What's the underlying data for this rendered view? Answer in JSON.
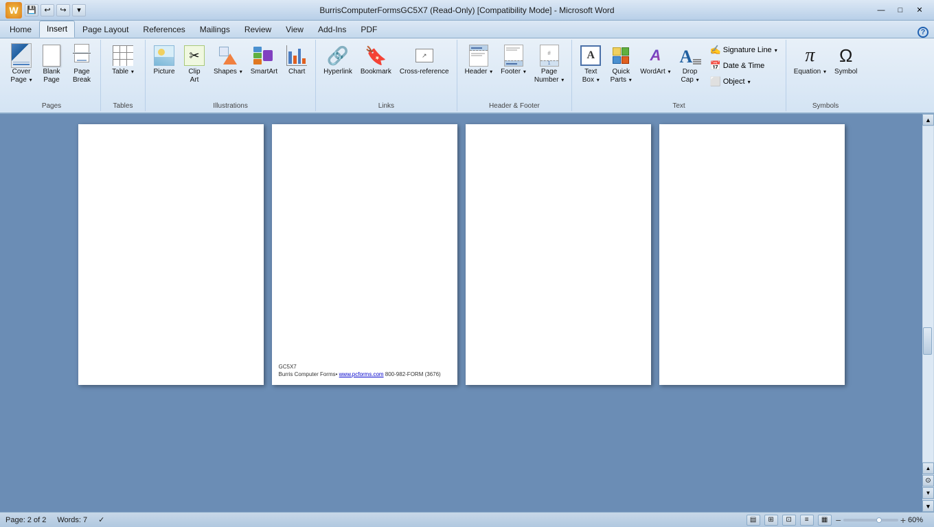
{
  "titlebar": {
    "title": "BurrisComputerFormsGC5X7 (Read-Only) [Compatibility Mode] - Microsoft Word",
    "min": "—",
    "max": "□",
    "close": "✕"
  },
  "quickaccess": {
    "save": "💾",
    "undo": "↩",
    "redo": "↪"
  },
  "tabs": [
    {
      "label": "Home"
    },
    {
      "label": "Insert"
    },
    {
      "label": "Page Layout"
    },
    {
      "label": "References"
    },
    {
      "label": "Mailings"
    },
    {
      "label": "Review"
    },
    {
      "label": "View"
    },
    {
      "label": "Add-Ins"
    },
    {
      "label": "PDF"
    }
  ],
  "activeTab": "Insert",
  "groups": {
    "pages": {
      "label": "Pages",
      "buttons": [
        {
          "id": "cover-page",
          "label": "Cover\nPage",
          "icon": "📄"
        },
        {
          "id": "blank-page",
          "label": "Blank\nPage",
          "icon": "🗋"
        },
        {
          "id": "page-break",
          "label": "Page\nBreak",
          "icon": "⋯"
        }
      ]
    },
    "tables": {
      "label": "Tables",
      "buttons": [
        {
          "id": "table",
          "label": "Table",
          "icon": "⊞"
        }
      ]
    },
    "illustrations": {
      "label": "Illustrations",
      "buttons": [
        {
          "id": "picture",
          "label": "Picture",
          "icon": "🖼"
        },
        {
          "id": "clip-art",
          "label": "Clip\nArt",
          "icon": "✂"
        },
        {
          "id": "shapes",
          "label": "Shapes",
          "icon": "△"
        },
        {
          "id": "smartart",
          "label": "SmartArt",
          "icon": "⬡"
        },
        {
          "id": "chart",
          "label": "Chart",
          "icon": "📊"
        }
      ]
    },
    "links": {
      "label": "Links",
      "buttons": [
        {
          "id": "hyperlink",
          "label": "Hyperlink",
          "icon": "🔗"
        },
        {
          "id": "bookmark",
          "label": "Bookmark",
          "icon": "🔖"
        },
        {
          "id": "cross-reference",
          "label": "Cross-reference",
          "icon": "↗"
        }
      ]
    },
    "header-footer": {
      "label": "Header & Footer",
      "buttons": [
        {
          "id": "header",
          "label": "Header",
          "icon": "▤"
        },
        {
          "id": "footer",
          "label": "Footer",
          "icon": "▥"
        },
        {
          "id": "page-number",
          "label": "Page\nNumber",
          "icon": "#"
        }
      ]
    },
    "text": {
      "label": "Text",
      "buttons_large": [
        {
          "id": "text-box",
          "label": "Text\nBox",
          "icon": "▭"
        },
        {
          "id": "quick-parts",
          "label": "Quick\nParts",
          "icon": "⚡"
        },
        {
          "id": "wordart",
          "label": "WordArt",
          "icon": "A"
        },
        {
          "id": "drop-cap",
          "label": "Drop\nCap",
          "icon": "A"
        }
      ],
      "buttons_small": [
        {
          "id": "signature-line",
          "label": "Signature Line",
          "icon": "✍",
          "dropdown": true
        },
        {
          "id": "date-time",
          "label": "Date & Time",
          "icon": "📅"
        },
        {
          "id": "object",
          "label": "Object",
          "icon": "⬜",
          "dropdown": true
        }
      ]
    },
    "symbols": {
      "label": "Symbols",
      "buttons": [
        {
          "id": "equation",
          "label": "Equation",
          "icon": "π"
        },
        {
          "id": "symbol",
          "label": "Symbol",
          "icon": "Ω"
        }
      ]
    }
  },
  "document": {
    "pages": [
      {
        "id": "page-1",
        "hasContent": false,
        "hasFooter": false
      },
      {
        "id": "page-2",
        "hasContent": false,
        "hasFooter": true,
        "footer_line1": "GC5X7",
        "footer_line2": "Burris Computer Forms• www.pcforms.com 800-982-FORM (3676)"
      },
      {
        "id": "page-3",
        "hasContent": false,
        "hasFooter": false
      },
      {
        "id": "page-4",
        "hasContent": false,
        "hasFooter": false
      }
    ]
  },
  "statusbar": {
    "page_info": "Page: 2 of 2",
    "words": "Words: 7",
    "spellcheck": "✓",
    "zoom_percent": "60%",
    "zoom_minus": "−",
    "zoom_plus": "+"
  }
}
